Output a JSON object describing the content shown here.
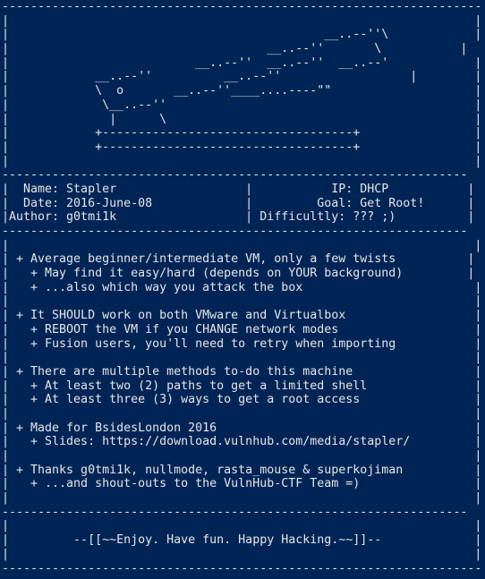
{
  "terminal": {
    "background_color": "#012456",
    "text_color": "#e6e6e6",
    "lines": [
      "-------------------------------------------------------------------",
      "|                                                                 |",
      "|                                            __..--''\\            |",
      "|                                    __..--''       \\           |",
      "|                          __..--''  __..--''  __..--'            |",
      "|            __..--''          __..--''                  |        |",
      "|            \\  o       __..--''____....----\"\"                    |",
      "|             \\__..--''                                           |",
      "|              |      \\                                           |",
      "|            +-----------------------------------+                |",
      "|            +-----------------------------------+                |",
      "|                                                                 |",
      "-----------------------------------------------------------------",
      "|  Name: Stapler                  |           IP: DHCP           |",
      "|  Date: 2016-June-08             |         Goal: Get Root!      |",
      "|Author: g0tmi1k                  | Difficultly: ??? ;)          |",
      "-----------------------------------------------------------------",
      "|                                                                 |",
      "| + Average beginner/intermediate VM, only a few twists          |",
      "|   + May find it easy/hard (depends on YOUR background)         |",
      "|   + ...also which way you attack the box                        |",
      "|                                                                 |",
      "| + It SHOULD work on both VMware and Virtualbox                  |",
      "|   + REBOOT the VM if you CHANGE network modes                   |",
      "|   + Fusion users, you'll need to retry when importing           |",
      "|                                                                 |",
      "| + There are multiple methods to-do this machine                 |",
      "|   + At least two (2) paths to get a limited shell               |",
      "|   + At least three (3) ways to get a root access                |",
      "|                                                                 |",
      "| + Made for BsidesLondon 2016                                    |",
      "|   + Slides: https://download.vulnhub.com/media/stapler/         |",
      "|                                                                 |",
      "| + Thanks g0tmi1k, nullmode, rasta_mouse & superkojiman          |",
      "|   + ...and shout-outs to the VulnHub-CTF Team =)                |",
      "|                                                                 |",
      "-----------------------------------------------------------------",
      "|                                                                 |",
      "|         --[[~~Enjoy. Have fun. Happy Hacking.~~]]--             |",
      "|                                                                 |",
      "-------------------------------------------------------------------"
    ]
  }
}
